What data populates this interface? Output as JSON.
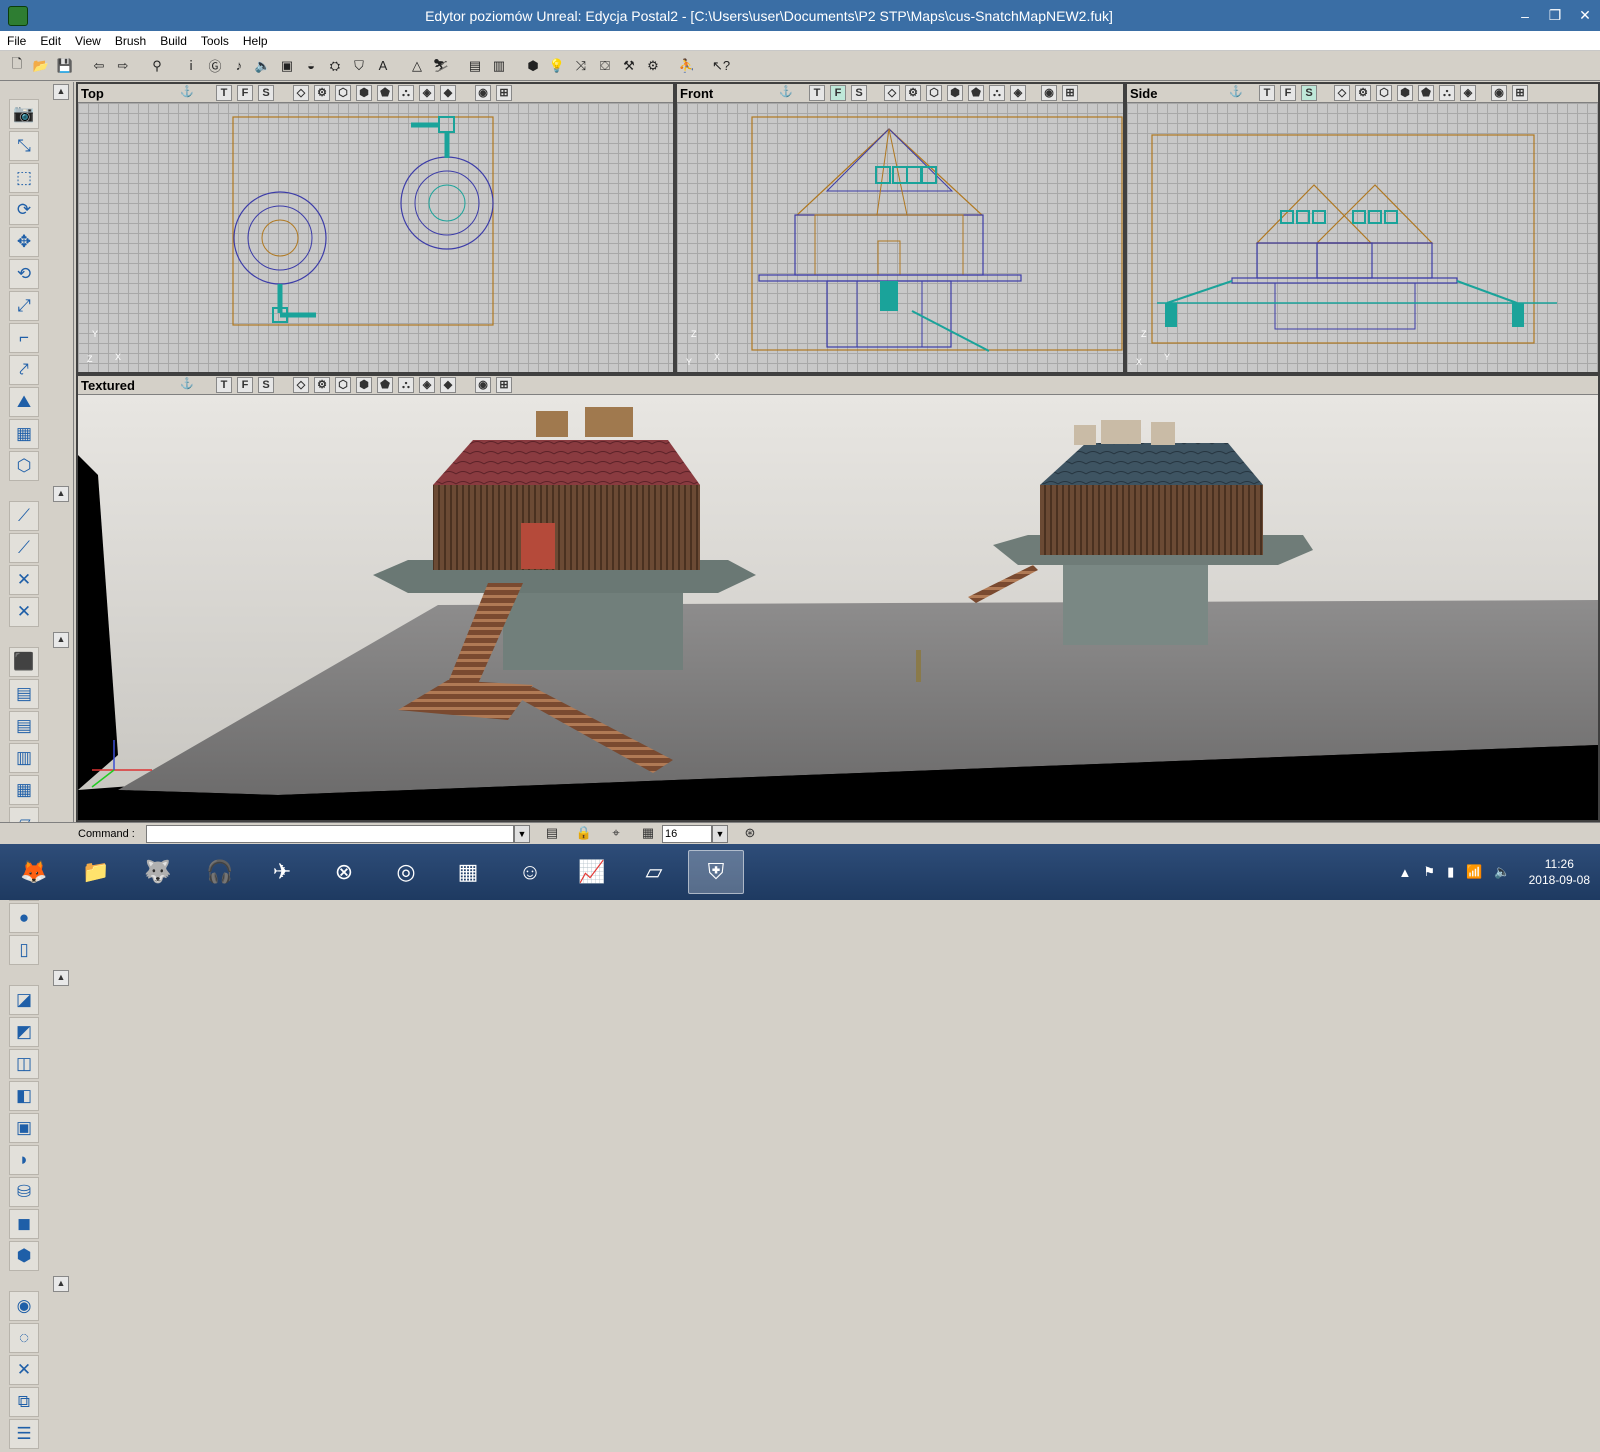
{
  "window": {
    "title": "Edytor poziomów Unreal: Edycja Postal2 - [C:\\Users\\user\\Documents\\P2 STP\\Maps\\cus-SnatchMapNEW2.fuk]",
    "minimize": "–",
    "maximize": "❐",
    "close": "✕"
  },
  "menu": [
    "File",
    "Edit",
    "View",
    "Brush",
    "Build",
    "Tools",
    "Help"
  ],
  "viewports": {
    "top": {
      "title": "Top",
      "axis_a": "Y",
      "axis_b": "X",
      "axis_c": "Z"
    },
    "front": {
      "title": "Front",
      "axis_a": "Z",
      "axis_b": "X",
      "axis_c": "Y"
    },
    "side": {
      "title": "Side",
      "axis_a": "Z",
      "axis_b": "Y",
      "axis_c": "X"
    },
    "textured": {
      "title": "Textured"
    }
  },
  "viewport_buttons": {
    "t": "T",
    "f": "F",
    "s": "S"
  },
  "status": {
    "command_label": "Command :",
    "command_value": "",
    "grid_size": "16"
  },
  "clock": {
    "time": "11:26",
    "date": "2018-09-08"
  },
  "colors": {
    "titlebar": "#3a6ea5",
    "wire_brush": "#3c3ca8",
    "wire_volume": "#b07820",
    "cyan": "#1aa39a"
  }
}
